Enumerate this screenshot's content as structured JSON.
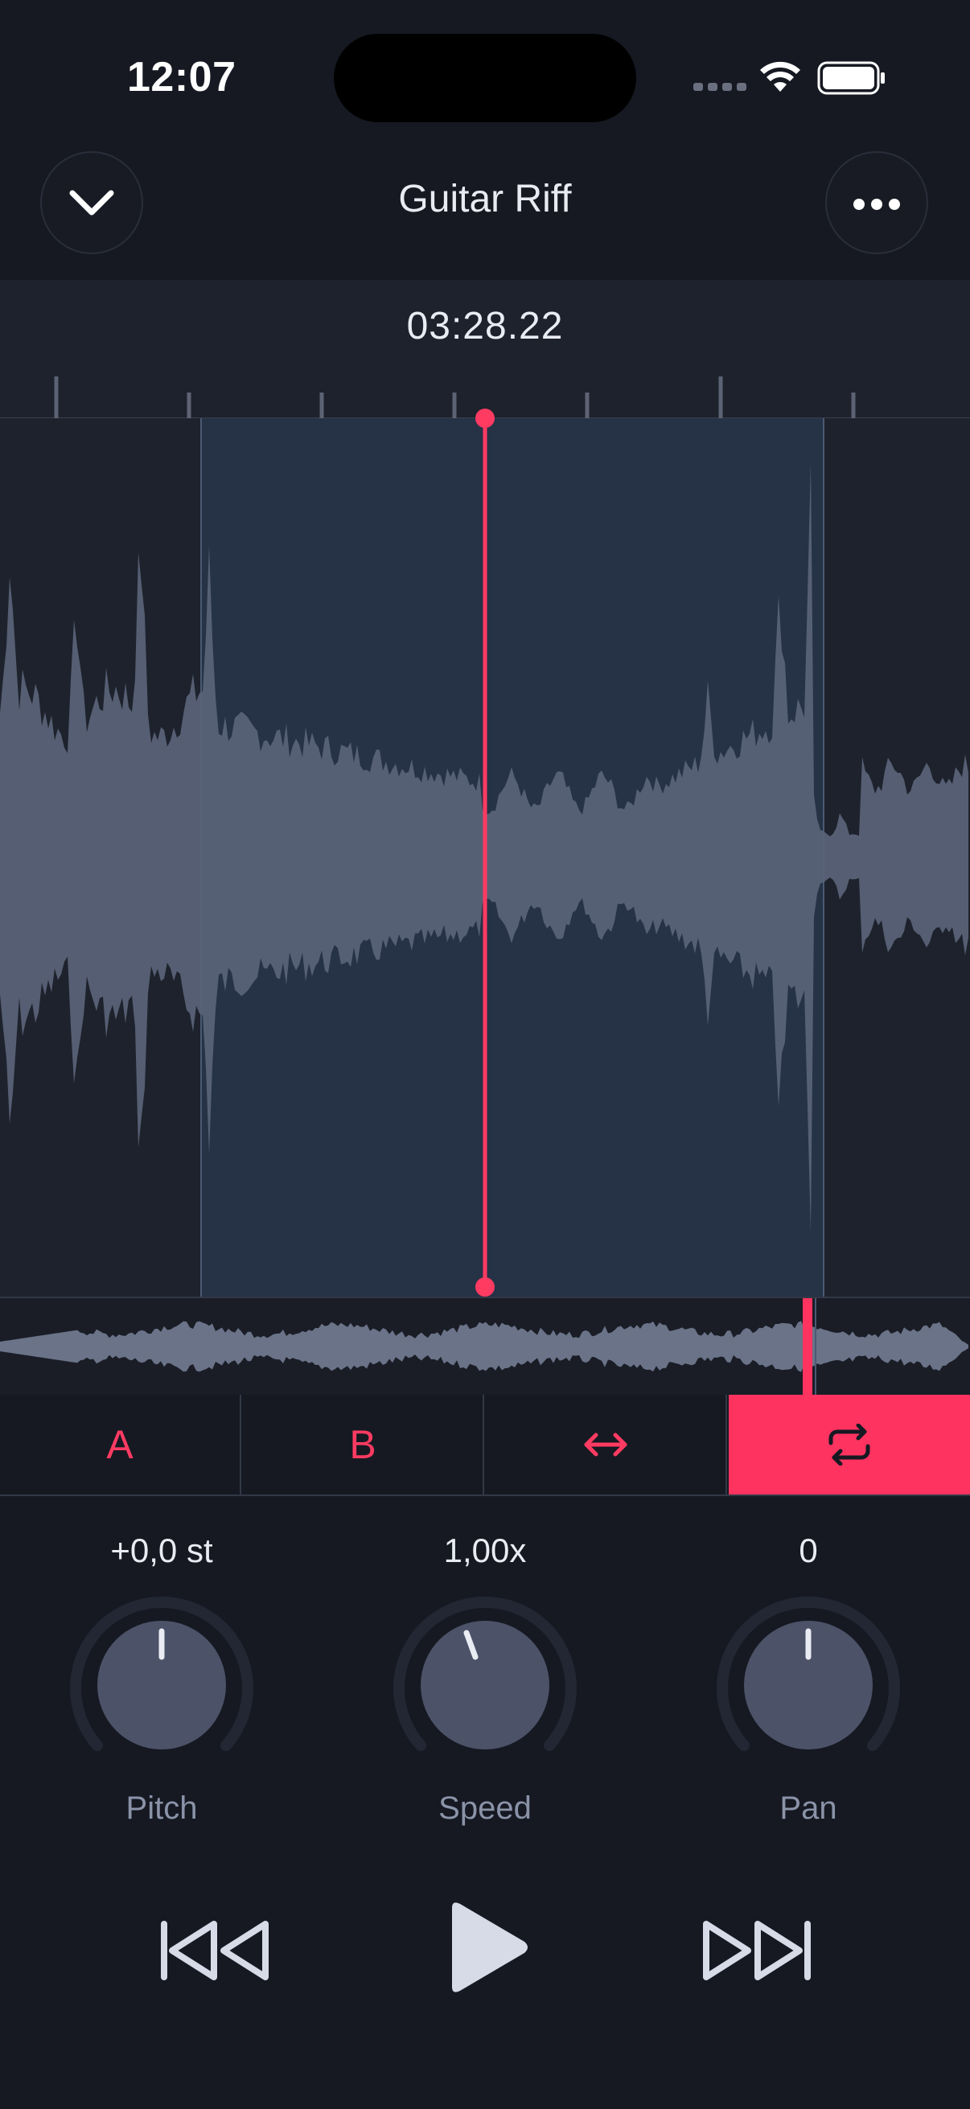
{
  "status_bar": {
    "time": "12:07"
  },
  "header": {
    "title": "Guitar Riff",
    "collapse_icon": "chevron-down-icon",
    "more_icon": "ellipsis-icon"
  },
  "timeline": {
    "current_time": "03:28.22"
  },
  "ab_controls": {
    "a_label": "A",
    "b_label": "B",
    "swap_icon": "swap-horizontal-icon",
    "loop_icon": "repeat-icon",
    "loop_active": true
  },
  "knobs": [
    {
      "label": "Pitch",
      "value": "+0,0 st"
    },
    {
      "label": "Speed",
      "value": "1,00x"
    },
    {
      "label": "Pan",
      "value": "0"
    }
  ],
  "transport": {
    "rewind_icon": "skip-back-icon",
    "play_icon": "play-icon",
    "forward_icon": "skip-forward-icon"
  },
  "colors": {
    "accent": "#ff3360",
    "background": "#161922",
    "waveform": "#5a6478",
    "selection": "#263246"
  }
}
